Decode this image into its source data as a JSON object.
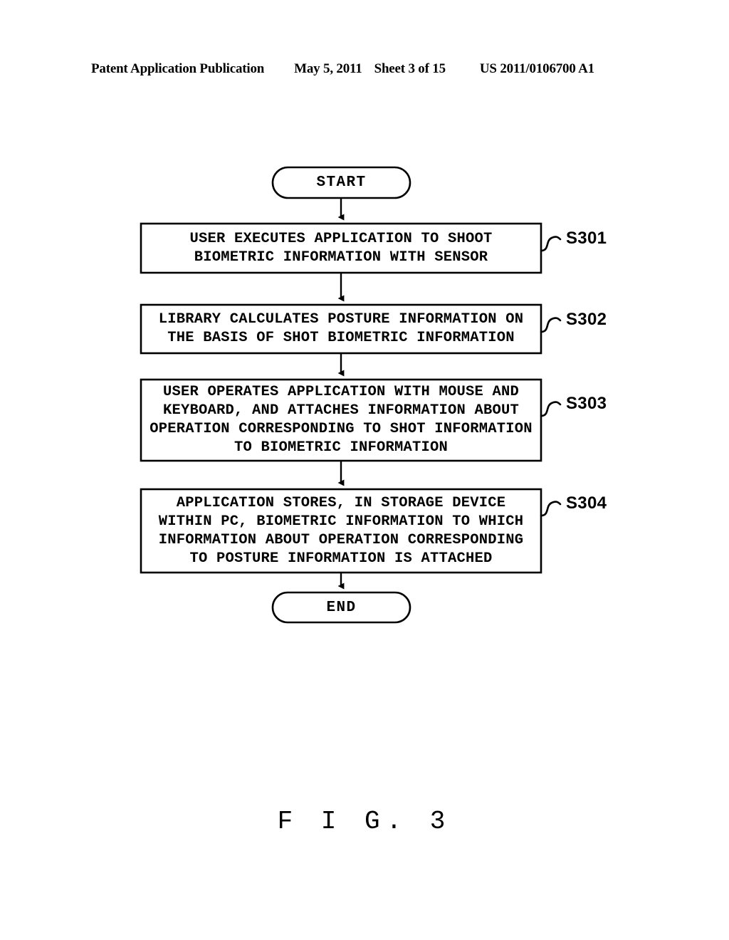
{
  "header": {
    "publication": "Patent Application Publication",
    "date": "May 5, 2011",
    "sheet": "Sheet 3 of 15",
    "patent_number": "US 2011/0106700 A1"
  },
  "figure": {
    "caption": "F I G.  3"
  },
  "flowchart": {
    "start": {
      "label": "START",
      "shape": "terminator"
    },
    "end": {
      "label": "END",
      "shape": "terminator"
    },
    "steps": [
      {
        "ref": "S301",
        "shape": "process",
        "lines": [
          "USER EXECUTES APPLICATION TO SHOOT",
          "BIOMETRIC INFORMATION WITH SENSOR"
        ]
      },
      {
        "ref": "S302",
        "shape": "process",
        "lines": [
          "LIBRARY CALCULATES POSTURE INFORMATION ON",
          "THE BASIS OF SHOT BIOMETRIC INFORMATION"
        ]
      },
      {
        "ref": "S303",
        "shape": "process",
        "lines": [
          "USER OPERATES APPLICATION WITH MOUSE AND",
          "KEYBOARD, AND ATTACHES INFORMATION ABOUT",
          "OPERATION CORRESPONDING TO SHOT INFORMATION",
          "TO BIOMETRIC INFORMATION"
        ]
      },
      {
        "ref": "S304",
        "shape": "process",
        "lines": [
          "APPLICATION STORES, IN STORAGE DEVICE",
          "WITHIN PC, BIOMETRIC INFORMATION TO WHICH",
          "INFORMATION ABOUT OPERATION CORRESPONDING",
          "TO POSTURE INFORMATION IS ATTACHED"
        ]
      }
    ],
    "colors": {
      "stroke": "#000000",
      "fill": "#ffffff",
      "text": "#000000"
    }
  }
}
